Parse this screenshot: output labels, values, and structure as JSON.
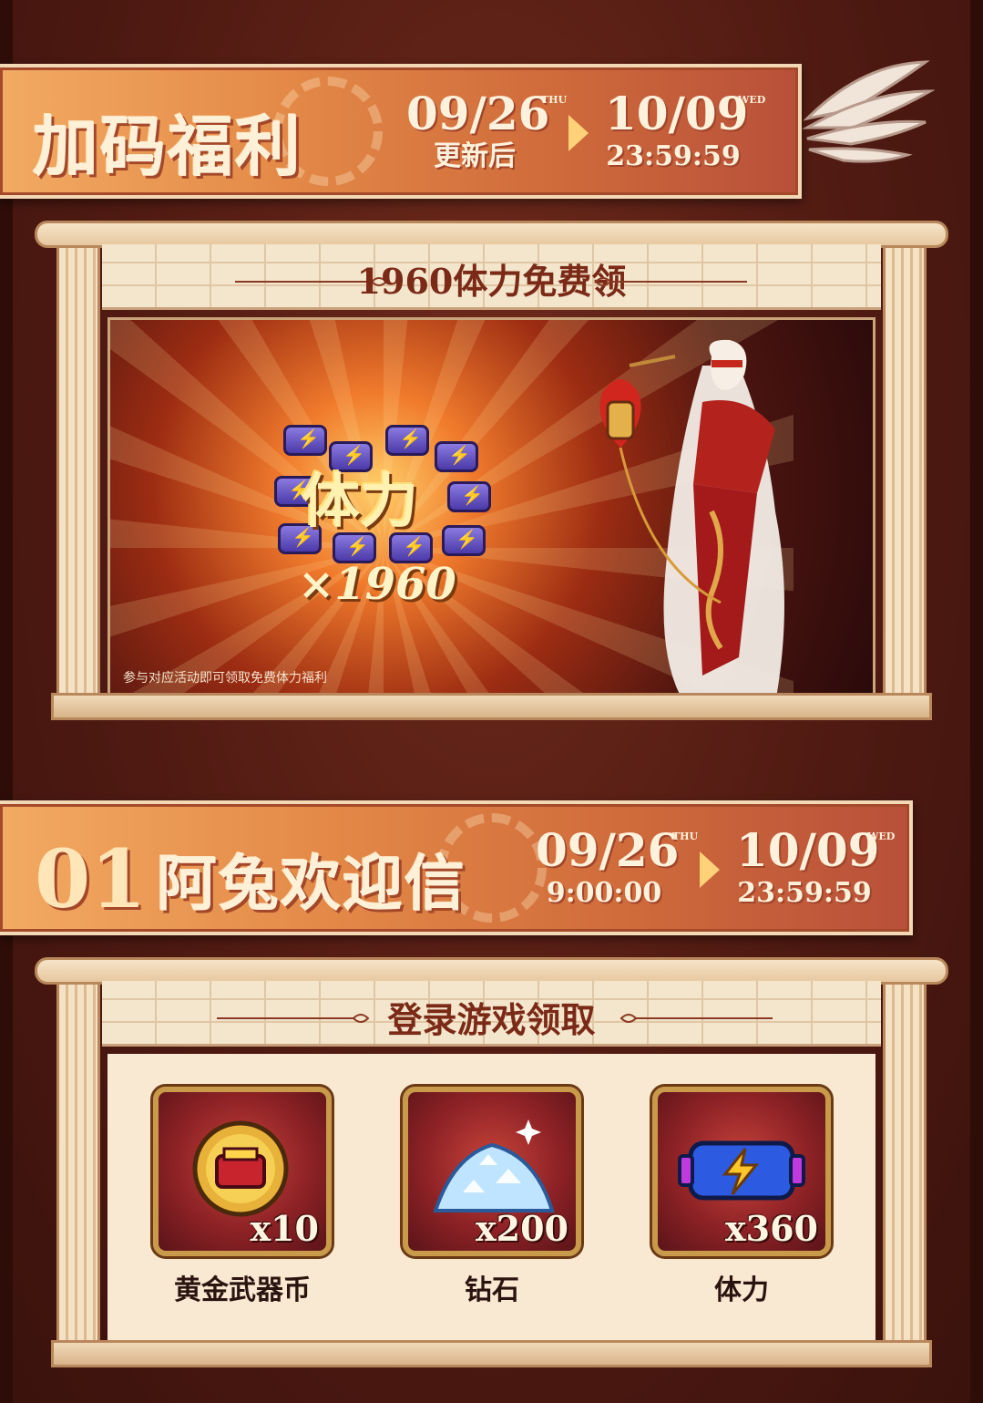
{
  "section1": {
    "title": "加码福利",
    "start": {
      "date": "09/26",
      "dow": "THU",
      "time": "更新后"
    },
    "end": {
      "date": "10/09",
      "dow": "WED",
      "time": "23:59:59"
    }
  },
  "event": {
    "heading": "1960体力免费领",
    "image_label": "体力",
    "image_count": "×1960",
    "caption": "参与对应活动即可领取免费体力福利"
  },
  "section2": {
    "number": "01",
    "title": "阿兔欢迎信",
    "start": {
      "date": "09/26",
      "dow": "THU",
      "time": "9:00:00"
    },
    "end": {
      "date": "10/09",
      "dow": "WED",
      "time": "23:59:59"
    }
  },
  "rewards": {
    "heading": "登录游戏领取",
    "items": [
      {
        "name": "黄金武器币",
        "qty": "x10",
        "icon": "gold-weapon-coin-icon"
      },
      {
        "name": "钻石",
        "qty": "x200",
        "icon": "diamond-pile-icon"
      },
      {
        "name": "体力",
        "qty": "x360",
        "icon": "stamina-battery-icon"
      }
    ]
  },
  "colors": {
    "banner": "#e48a48",
    "frame": "#f4e5cd",
    "title": "#7a2a17",
    "background": "#4f1a12"
  }
}
